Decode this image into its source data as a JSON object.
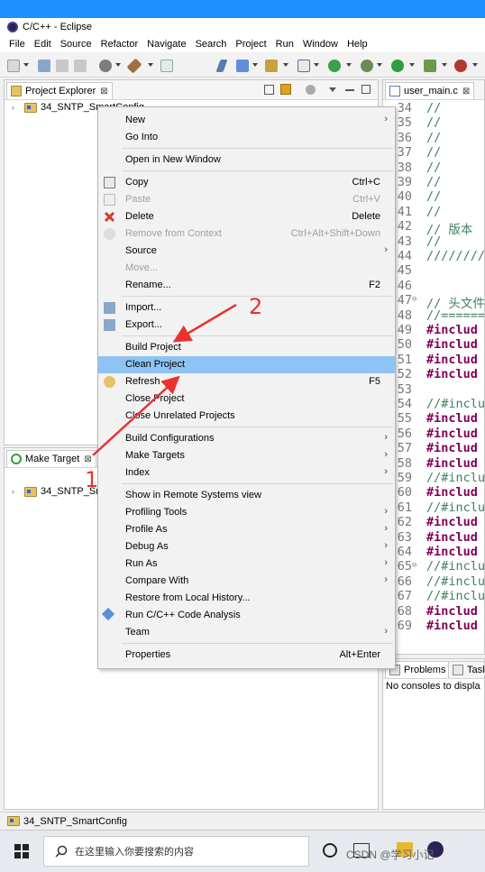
{
  "window": {
    "title": "C/C++ - Eclipse"
  },
  "menubar": {
    "items": [
      "File",
      "Edit",
      "Source",
      "Refactor",
      "Navigate",
      "Search",
      "Project",
      "Run",
      "Window",
      "Help"
    ]
  },
  "project_explorer": {
    "tab_label": "Project Explorer",
    "tab_close": "⊠",
    "tree": [
      {
        "label": "34_SNTP_SmartConfig"
      }
    ]
  },
  "make_target": {
    "tab_label": "Make Target",
    "tab_close": "⊠",
    "tree": [
      {
        "label": "34_SNTP_Sm"
      }
    ]
  },
  "editor": {
    "tab_label": "user_main.c",
    "tab_close": "⊠",
    "lines": [
      {
        "n": "34",
        "text": "//",
        "cls": "comment",
        "fold": ""
      },
      {
        "n": "35",
        "text": "//",
        "cls": "comment",
        "fold": ""
      },
      {
        "n": "36",
        "text": "//",
        "cls": "comment",
        "fold": ""
      },
      {
        "n": "37",
        "text": "//",
        "cls": "comment",
        "fold": ""
      },
      {
        "n": "38",
        "text": "//",
        "cls": "comment",
        "fold": ""
      },
      {
        "n": "39",
        "text": "//",
        "cls": "comment",
        "fold": ""
      },
      {
        "n": "40",
        "text": "//",
        "cls": "comment",
        "fold": ""
      },
      {
        "n": "41",
        "text": "//",
        "cls": "comment",
        "fold": ""
      },
      {
        "n": "42",
        "text": "//  版本",
        "cls": "comment",
        "fold": ""
      },
      {
        "n": "43",
        "text": "//",
        "cls": "comment",
        "fold": ""
      },
      {
        "n": "44",
        "text": "////////",
        "cls": "comment",
        "fold": ""
      },
      {
        "n": "45",
        "text": "",
        "cls": "",
        "fold": ""
      },
      {
        "n": "46",
        "text": "",
        "cls": "",
        "fold": ""
      },
      {
        "n": "47",
        "text": "// 头文件",
        "cls": "comment",
        "fold": "⊖"
      },
      {
        "n": "48",
        "text": "//======",
        "cls": "comment",
        "fold": ""
      },
      {
        "n": "49",
        "text": "#includ",
        "cls": "kw",
        "fold": ""
      },
      {
        "n": "50",
        "text": "#includ",
        "cls": "kw",
        "fold": ""
      },
      {
        "n": "51",
        "text": "#includ",
        "cls": "kw",
        "fold": ""
      },
      {
        "n": "52",
        "text": "#includ",
        "cls": "kw",
        "fold": ""
      },
      {
        "n": "53",
        "text": "",
        "cls": "",
        "fold": ""
      },
      {
        "n": "54",
        "text": "//#inclu",
        "cls": "comment",
        "fold": ""
      },
      {
        "n": "55",
        "text": "#includ",
        "cls": "kw",
        "fold": ""
      },
      {
        "n": "56",
        "text": "#includ",
        "cls": "kw",
        "fold": ""
      },
      {
        "n": "57",
        "text": "#includ",
        "cls": "kw",
        "fold": ""
      },
      {
        "n": "58",
        "text": "#includ",
        "cls": "kw",
        "fold": ""
      },
      {
        "n": "59",
        "text": "//#inclu",
        "cls": "comment",
        "fold": ""
      },
      {
        "n": "60",
        "text": "#includ",
        "cls": "kw",
        "fold": ""
      },
      {
        "n": "61",
        "text": "//#inclu",
        "cls": "comment",
        "fold": ""
      },
      {
        "n": "62",
        "text": "#includ",
        "cls": "kw",
        "fold": ""
      },
      {
        "n": "63",
        "text": "#includ",
        "cls": "kw",
        "fold": ""
      },
      {
        "n": "64",
        "text": "#includ",
        "cls": "kw",
        "fold": ""
      },
      {
        "n": "65",
        "text": "//#inclu",
        "cls": "comment",
        "fold": "⊖"
      },
      {
        "n": "66",
        "text": "//#inclu",
        "cls": "comment",
        "fold": ""
      },
      {
        "n": "67",
        "text": "//#inclu",
        "cls": "comment",
        "fold": ""
      },
      {
        "n": "68",
        "text": "#includ",
        "cls": "kw",
        "fold": ""
      },
      {
        "n": "69",
        "text": "#includ",
        "cls": "kw",
        "fold": ""
      }
    ]
  },
  "console": {
    "tabs": [
      {
        "label": "Problems"
      },
      {
        "label": "Task"
      }
    ],
    "message": "No consoles to displa"
  },
  "context_menu": {
    "items": [
      {
        "label": "New",
        "shortcut": "",
        "submenu": true,
        "disabled": false,
        "icon": ""
      },
      {
        "label": "Go Into",
        "shortcut": "",
        "submenu": false,
        "disabled": false,
        "icon": ""
      },
      {
        "sep": true
      },
      {
        "label": "Open in New Window",
        "shortcut": "",
        "submenu": false,
        "disabled": false,
        "icon": ""
      },
      {
        "sep": true
      },
      {
        "label": "Copy",
        "shortcut": "Ctrl+C",
        "submenu": false,
        "disabled": false,
        "icon": "copy"
      },
      {
        "label": "Paste",
        "shortcut": "Ctrl+V",
        "submenu": false,
        "disabled": true,
        "icon": "paste"
      },
      {
        "label": "Delete",
        "shortcut": "Delete",
        "submenu": false,
        "disabled": false,
        "icon": "delete"
      },
      {
        "label": "Remove from Context",
        "shortcut": "Ctrl+Alt+Shift+Down",
        "submenu": false,
        "disabled": true,
        "icon": "remove"
      },
      {
        "label": "Source",
        "shortcut": "",
        "submenu": true,
        "disabled": false,
        "icon": ""
      },
      {
        "label": "Move...",
        "shortcut": "",
        "submenu": false,
        "disabled": true,
        "icon": ""
      },
      {
        "label": "Rename...",
        "shortcut": "F2",
        "submenu": false,
        "disabled": false,
        "icon": ""
      },
      {
        "sep": true
      },
      {
        "label": "Import...",
        "shortcut": "",
        "submenu": false,
        "disabled": false,
        "icon": "import"
      },
      {
        "label": "Export...",
        "shortcut": "",
        "submenu": false,
        "disabled": false,
        "icon": "export"
      },
      {
        "sep": true
      },
      {
        "label": "Build Project",
        "shortcut": "",
        "submenu": false,
        "disabled": false,
        "icon": ""
      },
      {
        "label": "Clean Project",
        "shortcut": "",
        "submenu": false,
        "disabled": false,
        "icon": "",
        "highlighted": true
      },
      {
        "label": "Refresh",
        "shortcut": "F5",
        "submenu": false,
        "disabled": false,
        "icon": "refresh"
      },
      {
        "label": "Close Project",
        "shortcut": "",
        "submenu": false,
        "disabled": false,
        "icon": ""
      },
      {
        "label": "Close Unrelated Projects",
        "shortcut": "",
        "submenu": false,
        "disabled": false,
        "icon": ""
      },
      {
        "sep": true
      },
      {
        "label": "Build Configurations",
        "shortcut": "",
        "submenu": true,
        "disabled": false,
        "icon": ""
      },
      {
        "label": "Make Targets",
        "shortcut": "",
        "submenu": true,
        "disabled": false,
        "icon": ""
      },
      {
        "label": "Index",
        "shortcut": "",
        "submenu": true,
        "disabled": false,
        "icon": ""
      },
      {
        "sep": true
      },
      {
        "label": "Show in Remote Systems view",
        "shortcut": "",
        "submenu": false,
        "disabled": false,
        "icon": ""
      },
      {
        "label": "Profiling Tools",
        "shortcut": "",
        "submenu": true,
        "disabled": false,
        "icon": ""
      },
      {
        "label": "Profile As",
        "shortcut": "",
        "submenu": true,
        "disabled": false,
        "icon": ""
      },
      {
        "label": "Debug As",
        "shortcut": "",
        "submenu": true,
        "disabled": false,
        "icon": ""
      },
      {
        "label": "Run As",
        "shortcut": "",
        "submenu": true,
        "disabled": false,
        "icon": ""
      },
      {
        "label": "Compare With",
        "shortcut": "",
        "submenu": true,
        "disabled": false,
        "icon": ""
      },
      {
        "label": "Restore from Local History...",
        "shortcut": "",
        "submenu": false,
        "disabled": false,
        "icon": ""
      },
      {
        "label": "Run C/C++ Code Analysis",
        "shortcut": "",
        "submenu": false,
        "disabled": false,
        "icon": "analysis"
      },
      {
        "label": "Team",
        "shortcut": "",
        "submenu": true,
        "disabled": false,
        "icon": ""
      },
      {
        "sep": true
      },
      {
        "label": "Properties",
        "shortcut": "Alt+Enter",
        "submenu": false,
        "disabled": false,
        "icon": ""
      }
    ]
  },
  "statusbar": {
    "text": "34_SNTP_SmartConfig"
  },
  "taskbar": {
    "search_placeholder": "在这里输入你要搜索的内容",
    "watermark": "CSDN @学习小记"
  },
  "annotations": {
    "label1": "1",
    "label2": "2"
  },
  "colors": {
    "highlight": "#8fc3f3",
    "annotation": "#e8332f",
    "top_strip": "#1e90ff"
  }
}
